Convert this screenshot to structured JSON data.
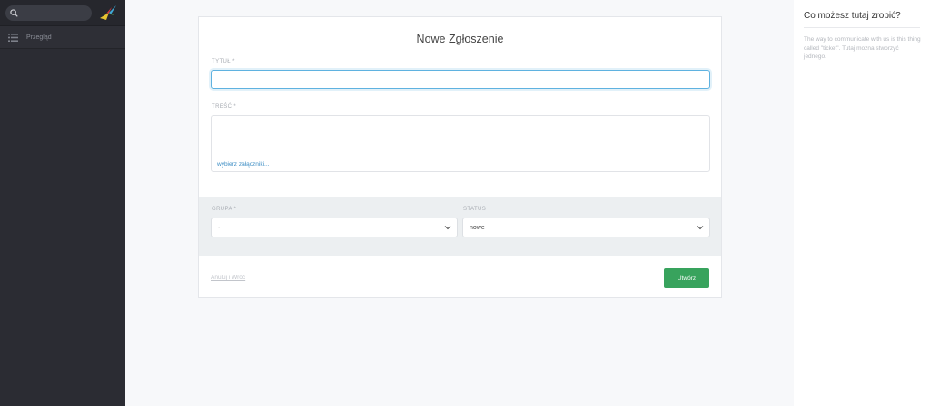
{
  "sidebar": {
    "search": {
      "value": "",
      "placeholder": ""
    },
    "nav": [
      {
        "label": "Przegląd"
      }
    ]
  },
  "form": {
    "title": "Nowe Zgłoszenie",
    "title_field": {
      "label": "TYTUŁ *",
      "value": ""
    },
    "body_field": {
      "label": "TREŚĆ *",
      "attach_label": "wybierz załączniki..."
    },
    "group_field": {
      "label": "GRUPA *",
      "value": "-"
    },
    "status_field": {
      "label": "STATUS",
      "value": "nowe"
    },
    "discard_label": "Anuluj i Wróć",
    "submit_label": "Utwórz"
  },
  "help": {
    "title": "Co możesz tutaj zrobić?",
    "text": "The way to communicate with us is this thing called \"ticket\". Tutaj można stworzyć jednego."
  },
  "colors": {
    "sidebar_bg": "#2b2c33",
    "accent_blue": "#5fb2e0",
    "submit_green": "#38a35d",
    "link_blue": "#3f8fc5"
  }
}
